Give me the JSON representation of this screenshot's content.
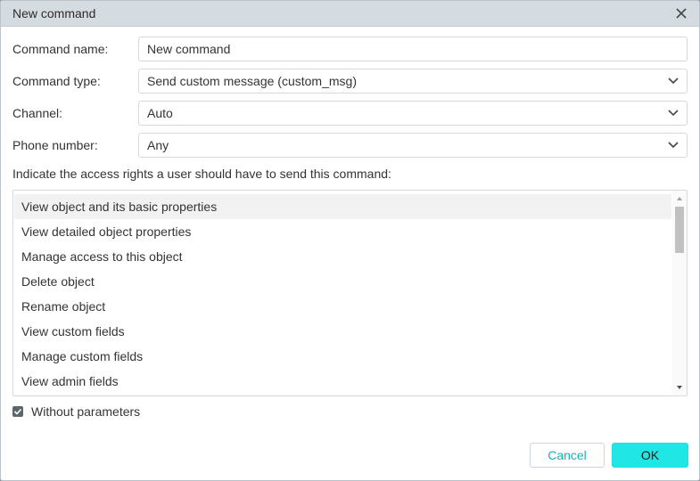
{
  "dialog": {
    "title": "New command",
    "close_icon": "close-icon"
  },
  "form": {
    "command_name": {
      "label": "Command name:",
      "value": "New command"
    },
    "command_type": {
      "label": "Command type:",
      "value": "Send custom message (custom_msg)"
    },
    "channel": {
      "label": "Channel:",
      "value": "Auto"
    },
    "phone_number": {
      "label": "Phone number:",
      "value": "Any"
    }
  },
  "access": {
    "hint": "Indicate the access rights a user should have to send this command:",
    "items": [
      "View object and its basic properties",
      "View detailed object properties",
      "Manage access to this object",
      "Delete object",
      "Rename object",
      "View custom fields",
      "Manage custom fields",
      "View admin fields"
    ],
    "selected_index": 0
  },
  "without_parameters": {
    "label": "Without parameters",
    "checked": true
  },
  "buttons": {
    "cancel": "Cancel",
    "ok": "OK"
  },
  "colors": {
    "accent": "#20e6e6",
    "cancel_text": "#17b3b3",
    "titlebar": "#d5dce1"
  }
}
